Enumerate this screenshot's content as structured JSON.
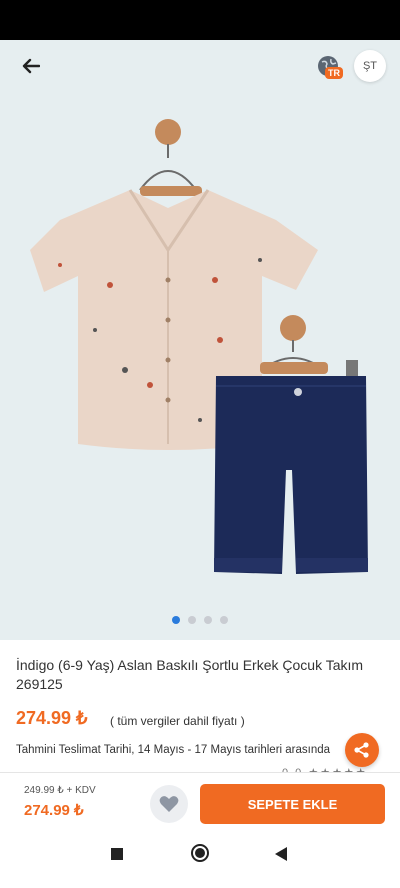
{
  "header": {
    "language_badge": "TR",
    "currency_label": "ŞT"
  },
  "gallery": {
    "image_count": 4,
    "active_index": 0
  },
  "product": {
    "title": "İndigo (6-9 Yaş) Aslan Baskılı Şortlu Erkek Çocuk Takım 269125",
    "price": "274.99 ₺",
    "tax_note": "( tüm vergiler dahil fiyatı )",
    "delivery": "Tahmini Teslimat Tarihi, 14 Mayıs - 17 Mayıs tarihleri arasında",
    "rating_peek": "0.0 ★★★★★"
  },
  "bottom_bar": {
    "old_price": "249.99 ₺ + KDV",
    "price": "274.99 ₺",
    "add_to_cart_label": "SEPETE EKLE"
  },
  "colors": {
    "accent": "#f06a22",
    "dot_active": "#2a7bdc",
    "background": "#e6eef0"
  }
}
